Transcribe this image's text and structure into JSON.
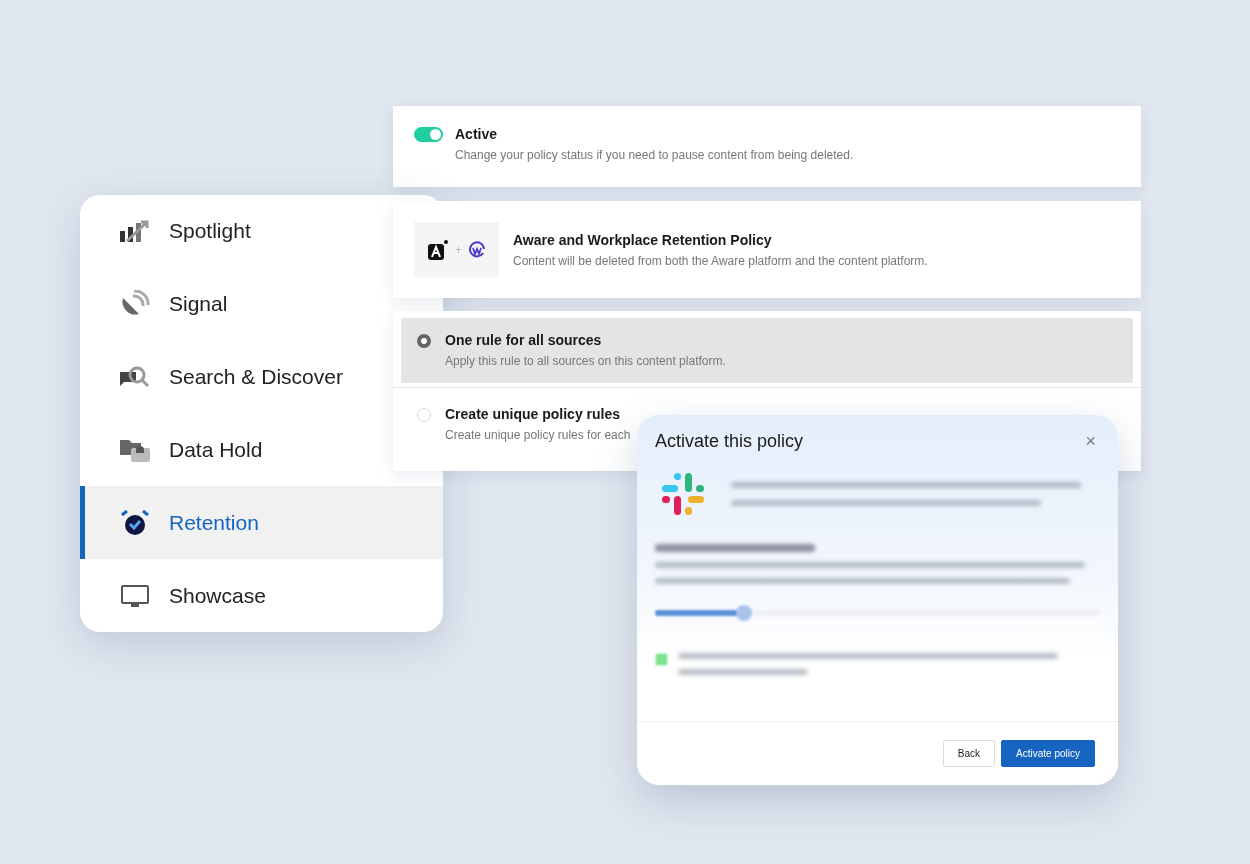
{
  "sidebar": {
    "items": [
      {
        "label": "Spotlight",
        "selected": false
      },
      {
        "label": "Signal",
        "selected": false
      },
      {
        "label": "Search & Discover",
        "selected": false
      },
      {
        "label": "Data Hold",
        "selected": false
      },
      {
        "label": "Retention",
        "selected": true
      },
      {
        "label": "Showcase",
        "selected": false
      }
    ]
  },
  "status_card": {
    "on": true,
    "title": "Active",
    "description": "Change your policy status if you need to pause content from being deleted."
  },
  "policy_card": {
    "plus": "+",
    "title": "Aware and Workplace Retention Policy",
    "description": "Content will be deleted from both the Aware platform and the content platform."
  },
  "rules": [
    {
      "title": "One rule for all sources",
      "description": "Apply this rule to all sources on this content platform.",
      "selected": true
    },
    {
      "title": "Create unique policy rules",
      "description": "Create unique policy rules for each",
      "selected": false
    }
  ],
  "modal": {
    "title": "Activate this policy",
    "close": "×",
    "slider": {
      "level": 0.2
    },
    "option": {
      "checked": true
    },
    "buttons": [
      {
        "label": "Back",
        "kind": "secondary"
      },
      {
        "label": "Activate policy",
        "kind": "primary"
      }
    ]
  }
}
